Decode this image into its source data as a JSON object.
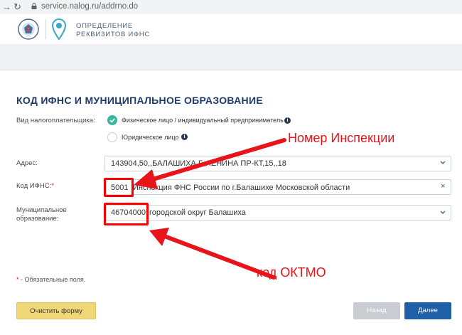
{
  "browser": {
    "url": "service.nalog.ru/addrno.do"
  },
  "header": {
    "app_title_line1": "ОПРЕДЕЛЕНИЕ",
    "app_title_line2": "РЕКВИЗИТОВ ИФНС"
  },
  "form": {
    "title": "КОД ИФНС И МУНИЦИПАЛЬНОЕ ОБРАЗОВАНИЕ",
    "taxpayer_type_label": "Вид налогоплательщика:",
    "taxpayer_options": [
      {
        "label": "Физическое лицо / индивидуальный предприниматель",
        "selected": true
      },
      {
        "label": "Юридическое лицо",
        "selected": false
      }
    ],
    "address_label": "Адрес:",
    "address_value": "143904,50,,БАЛАШИХА Г,,ЛЕНИНА ПР-КТ,15,,18",
    "ifns_label": "Код ИФНС:",
    "required_mark": "*",
    "ifns_code": "5001",
    "ifns_name": "Инспекция ФНС России по г.Балашихе Московской области",
    "clear_symbol": "×",
    "municipal_label_line1": "Муниципальное",
    "municipal_label_line2": "образование:",
    "oktmo_code": "46704000",
    "municipal_name": "городской округ Балашиха",
    "required_note_star": "*",
    "required_note": " - Обязательные поля."
  },
  "buttons": {
    "clear": "Очистить форму",
    "back": "Назад",
    "next": "Далее"
  },
  "annotations": {
    "inspection": "Номер Инспекции",
    "oktmo": "код  ОКТМО"
  },
  "colors": {
    "accent_red": "#e8141b",
    "primary_blue": "#1e5fa8",
    "yellow_button": "#f0d878",
    "teal_radio": "#3cb5a0"
  }
}
